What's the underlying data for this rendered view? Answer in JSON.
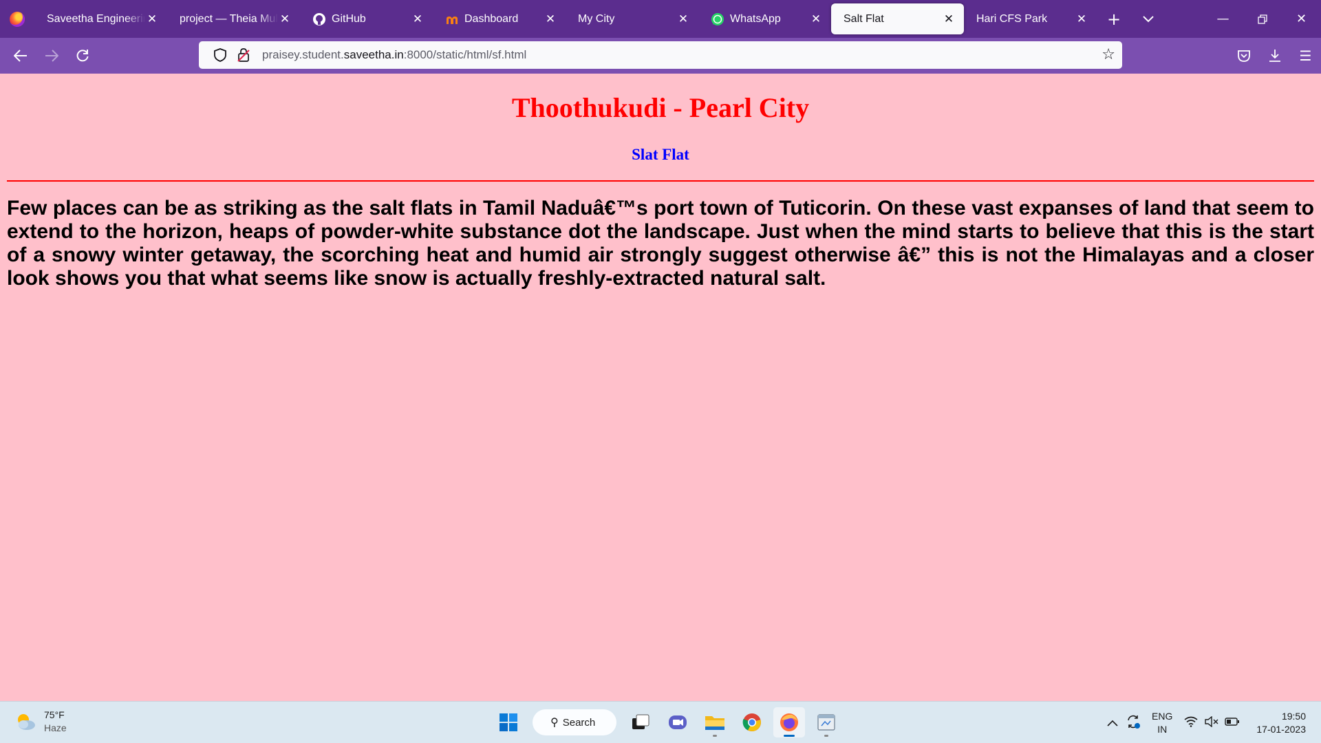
{
  "browser": {
    "tabs": [
      {
        "label": "Saveetha Engineering",
        "favicon": "none",
        "active": false
      },
      {
        "label": "project — Theia Multi-",
        "favicon": "none",
        "active": false
      },
      {
        "label": "GitHub",
        "favicon": "github-icon",
        "active": false
      },
      {
        "label": "Dashboard",
        "favicon": "moodle-icon",
        "active": false
      },
      {
        "label": "My City",
        "favicon": "none",
        "active": false
      },
      {
        "label": "WhatsApp",
        "favicon": "whatsapp-icon",
        "active": false
      },
      {
        "label": "Salt Flat",
        "favicon": "none",
        "active": true
      },
      {
        "label": "Hari CFS Park",
        "favicon": "none",
        "active": false
      }
    ],
    "url_prefix": "praisey.student.",
    "url_domain": "saveetha.in",
    "url_suffix": ":8000/static/html/sf.html",
    "colors": {
      "tabbar": "#5b2d8e",
      "navbar": "#7b4fb0"
    }
  },
  "page": {
    "heading": "Thoothukudi - Pearl City",
    "subheading": "Slat Flat",
    "paragraph": "Few places can be as striking as the salt flats in Tamil Naduâ€™s port town of Tuticorin. On these vast expanses of land that seem to extend to the horizon, heaps of powder-white substance dot the landscape. Just when the mind starts to believe that this is the start of a snowy winter getaway, the scorching heat and humid air strongly suggest otherwise â€” this is not the Himalayas and a closer look shows you that what seems like snow is actually freshly-extracted natural salt.",
    "colors": {
      "background": "#ffc0cb",
      "heading": "#ff0000",
      "subheading": "#0000ff",
      "rule": "#ff0000"
    }
  },
  "taskbar": {
    "weather_temp": "75°F",
    "weather_desc": "Haze",
    "search_label": "Search",
    "lang_line1": "ENG",
    "lang_line2": "IN",
    "time": "19:50",
    "date": "17-01-2023"
  }
}
